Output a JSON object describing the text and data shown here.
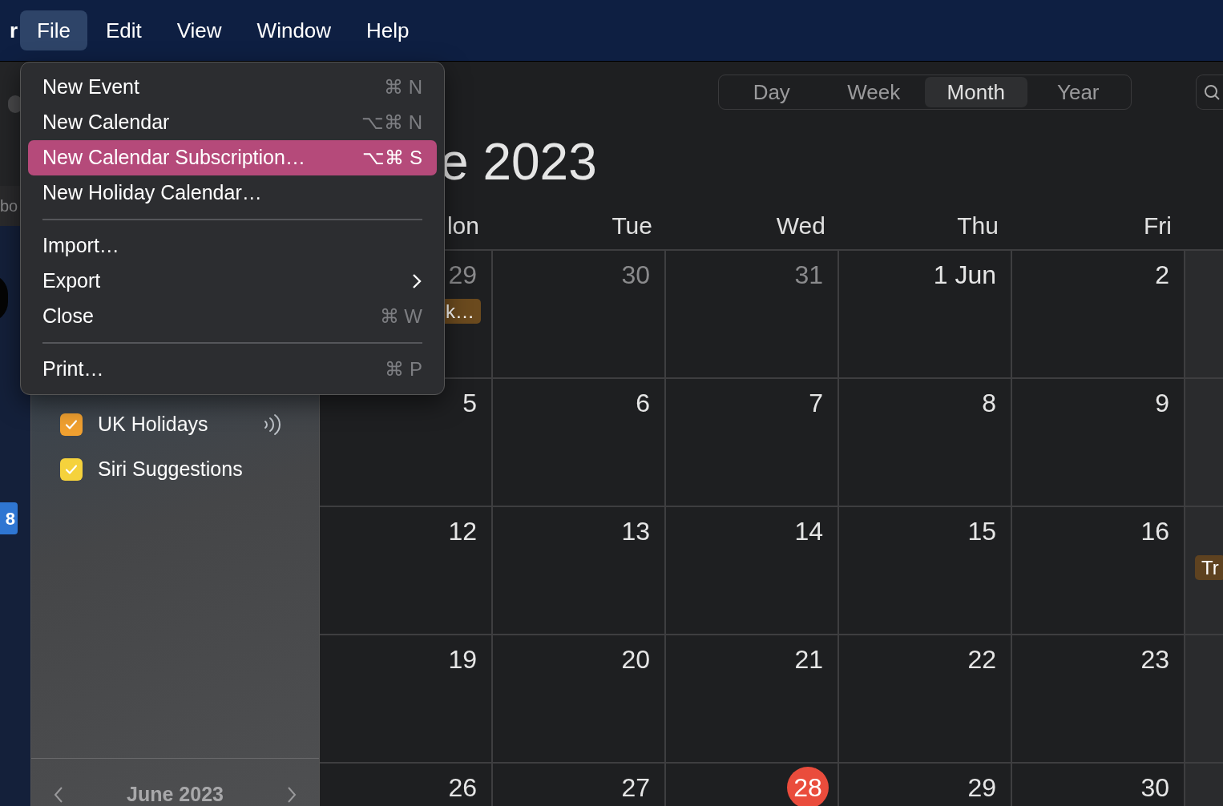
{
  "menu_bar": {
    "app_fragment": "r",
    "items": [
      {
        "label": "File",
        "selected": true
      },
      {
        "label": "Edit",
        "selected": false
      },
      {
        "label": "View",
        "selected": false
      },
      {
        "label": "Window",
        "selected": false
      },
      {
        "label": "Help",
        "selected": false
      }
    ]
  },
  "file_menu": {
    "items": [
      {
        "kind": "item",
        "label": "New Event",
        "shortcut": "⌘ N",
        "selected": false
      },
      {
        "kind": "item",
        "label": "New Calendar",
        "shortcut": "⌥⌘ N",
        "selected": false
      },
      {
        "kind": "item",
        "label": "New Calendar Subscription…",
        "shortcut": "⌥⌘ S",
        "selected": true
      },
      {
        "kind": "item",
        "label": "New Holiday Calendar…",
        "selected": false
      },
      {
        "kind": "separator"
      },
      {
        "kind": "item",
        "label": "Import…",
        "selected": false
      },
      {
        "kind": "submenu",
        "label": "Export",
        "selected": false
      },
      {
        "kind": "item",
        "label": "Close",
        "shortcut": "⌘ W",
        "selected": false
      },
      {
        "kind": "separator"
      },
      {
        "kind": "item",
        "label": "Print…",
        "shortcut": "⌘ P",
        "selected": false
      }
    ]
  },
  "background_window": {
    "label_fragment": "bo",
    "badge": "8"
  },
  "sidebar": {
    "calendars": [
      {
        "name": "UK Holidays",
        "checked": true,
        "color": "#f0a030",
        "subscribed": true
      },
      {
        "name": "Siri Suggestions",
        "checked": true,
        "color": "#f5d23c",
        "subscribed": false
      }
    ],
    "mini_month": "June 2023"
  },
  "toolbar": {
    "views": [
      {
        "label": "Day",
        "selected": false
      },
      {
        "label": "Week",
        "selected": false
      },
      {
        "label": "Month",
        "selected": true
      },
      {
        "label": "Year",
        "selected": false
      }
    ]
  },
  "title": "e 2023",
  "weekdays": [
    "lon",
    "Tue",
    "Wed",
    "Thu",
    "Fri"
  ],
  "weeks": [
    {
      "days": [
        {
          "label": "29",
          "muted": true,
          "today": false,
          "events": [
            {
              "title": "k…",
              "color": "#6b4a1e"
            }
          ]
        },
        {
          "label": "30",
          "muted": true,
          "today": false
        },
        {
          "label": "31",
          "muted": true,
          "today": false
        },
        {
          "label": "1 Jun",
          "muted": false,
          "today": false
        },
        {
          "label": "2",
          "muted": false,
          "today": false
        }
      ]
    },
    {
      "days": [
        {
          "label": "5",
          "muted": false,
          "today": false
        },
        {
          "label": "6",
          "muted": false,
          "today": false
        },
        {
          "label": "7",
          "muted": false,
          "today": false
        },
        {
          "label": "8",
          "muted": false,
          "today": false
        },
        {
          "label": "9",
          "muted": false,
          "today": false
        }
      ]
    },
    {
      "days": [
        {
          "label": "12",
          "muted": false,
          "today": false
        },
        {
          "label": "13",
          "muted": false,
          "today": false
        },
        {
          "label": "14",
          "muted": false,
          "today": false
        },
        {
          "label": "15",
          "muted": false,
          "today": false
        },
        {
          "label": "16",
          "muted": false,
          "today": false
        }
      ],
      "weekend_events": [
        {
          "title": "Tr",
          "color": "#5e4220"
        }
      ]
    },
    {
      "days": [
        {
          "label": "19",
          "muted": false,
          "today": false
        },
        {
          "label": "20",
          "muted": false,
          "today": false
        },
        {
          "label": "21",
          "muted": false,
          "today": false
        },
        {
          "label": "22",
          "muted": false,
          "today": false
        },
        {
          "label": "23",
          "muted": false,
          "today": false
        }
      ]
    },
    {
      "days": [
        {
          "label": "26",
          "muted": false,
          "today": false
        },
        {
          "label": "27",
          "muted": false,
          "today": false
        },
        {
          "label": "28",
          "muted": false,
          "today": true
        },
        {
          "label": "29",
          "muted": false,
          "today": false
        },
        {
          "label": "30",
          "muted": false,
          "today": false
        }
      ]
    }
  ]
}
